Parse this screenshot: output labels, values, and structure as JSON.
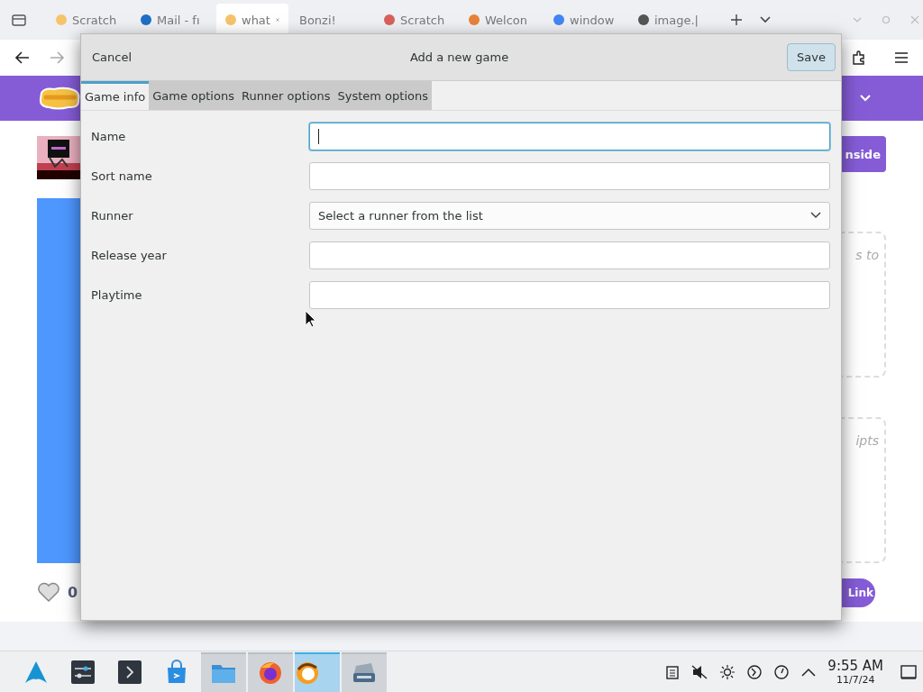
{
  "browser": {
    "tabs": [
      {
        "label": "Scratch",
        "selected": false
      },
      {
        "label": "Mail - fı",
        "selected": false
      },
      {
        "label": "what",
        "selected": true
      },
      {
        "label": "Bonzi!",
        "selected": false
      },
      {
        "label": "Scratch",
        "selected": false
      },
      {
        "label": "Welcon",
        "selected": false
      },
      {
        "label": "window",
        "selected": false
      },
      {
        "label": "image.|",
        "selected": false
      }
    ]
  },
  "page": {
    "button_text": "nside",
    "hint_1": "s to",
    "hint_2": "ipts",
    "link_text": "Link",
    "like_count": "0"
  },
  "dialog": {
    "title": "Add a new game",
    "cancel": "Cancel",
    "save": "Save",
    "tabs": [
      {
        "label": "Game info",
        "selected": true
      },
      {
        "label": "Game options",
        "selected": false
      },
      {
        "label": "Runner options",
        "selected": false
      },
      {
        "label": "System options",
        "selected": false
      }
    ],
    "fields": [
      {
        "kind": "text",
        "label": "Name",
        "focused": true
      },
      {
        "kind": "text",
        "label": "Sort name",
        "focused": false
      },
      {
        "kind": "select",
        "label": "Runner",
        "value": "Select a runner from the list",
        "focused": false
      },
      {
        "kind": "text",
        "label": "Release year",
        "focused": false
      },
      {
        "kind": "text",
        "label": "Playtime",
        "focused": false
      }
    ]
  },
  "taskbar": {
    "tasks": [
      {
        "running": false,
        "selected": false
      },
      {
        "running": false,
        "selected": false
      },
      {
        "running": false,
        "selected": false
      },
      {
        "running": false,
        "selected": false
      },
      {
        "running": true,
        "selected": false
      },
      {
        "running": true,
        "selected": false
      },
      {
        "running": true,
        "selected": true
      },
      {
        "running": true,
        "selected": false
      }
    ],
    "time": "9:55 AM",
    "date": "11/7/24"
  }
}
